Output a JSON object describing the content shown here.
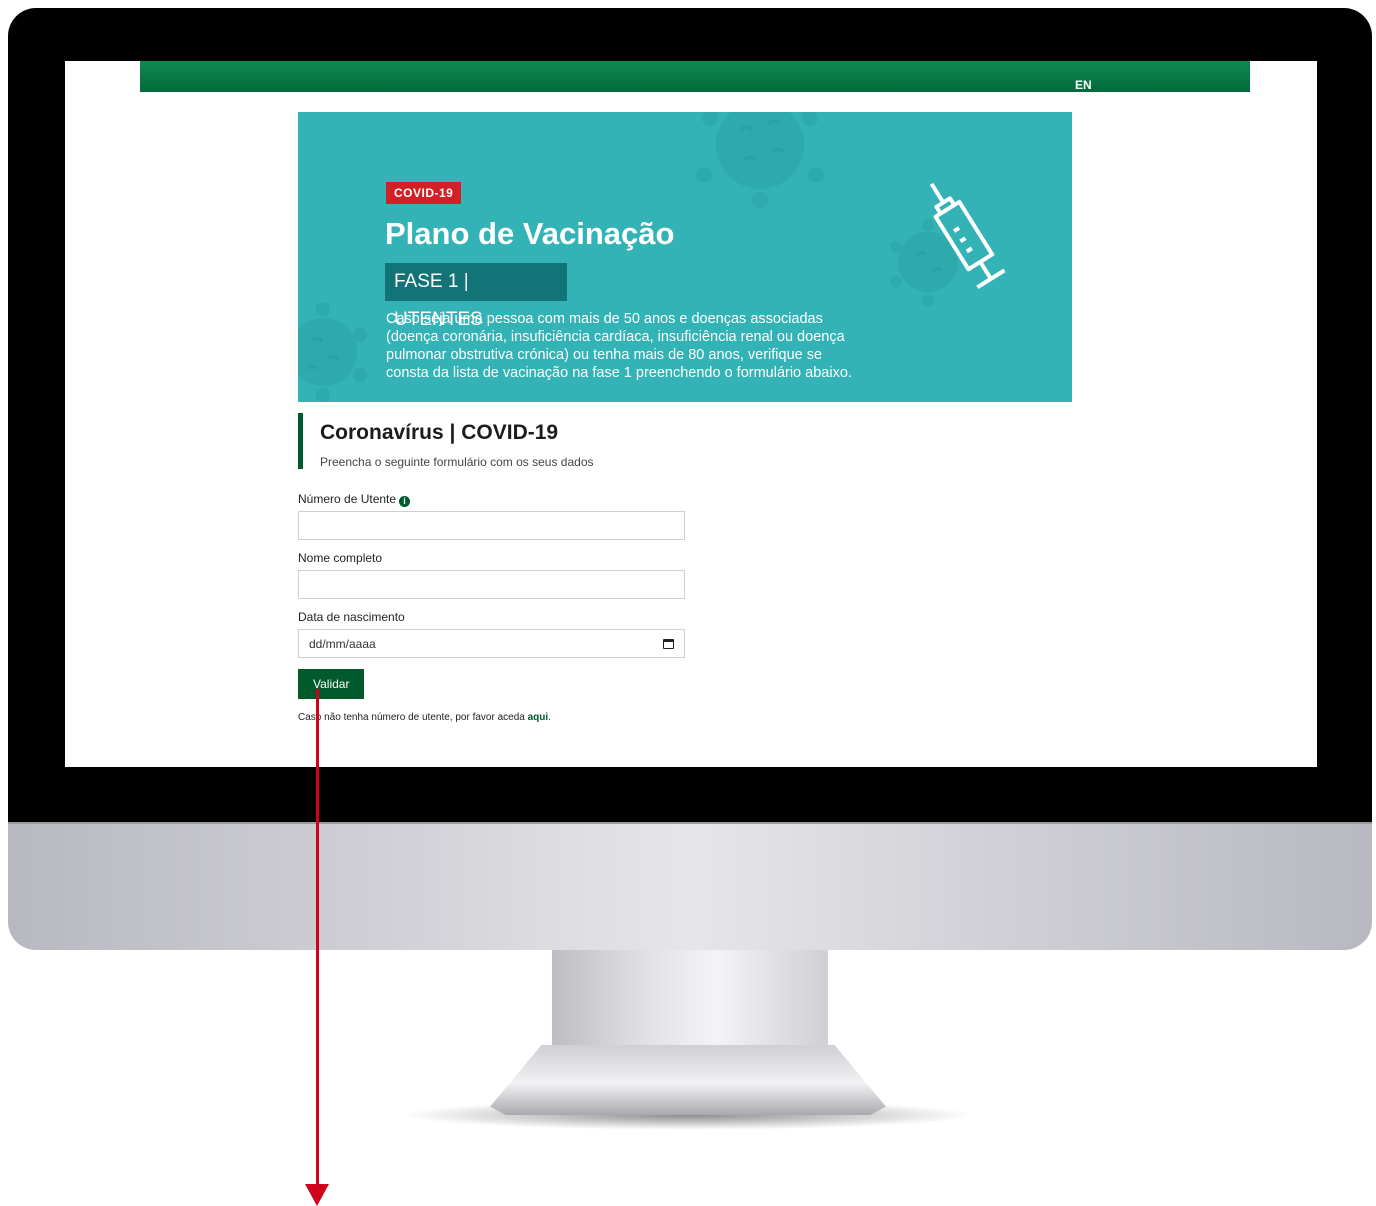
{
  "header": {
    "lang_label": "EN"
  },
  "banner": {
    "badge": "COVID-19",
    "title": "Plano de Vacinação",
    "phase": "FASE 1 | UTENTES",
    "text": "Caso seja uma pessoa com mais de 50 anos e doenças associadas (doença coronária, insuficiência cardíaca, insuficiência renal ou doença pulmonar obstrutiva crónica) ou tenha mais de 80 anos, verifique se consta da lista de vacinação na fase 1 preenchendo o formulário abaixo."
  },
  "form": {
    "title": "Coronavírus | COVID-19",
    "subtitle": "Preencha o seguinte formulário com os seus dados",
    "utente_label": "Número de Utente",
    "name_label": "Nome completo",
    "dob_label": "Data de nascimento",
    "dob_placeholder": "dd/mm/aaaa",
    "submit_label": "Validar",
    "footnote_text": "Caso não tenha número de utente, por favor aceda",
    "footnote_link": "aqui",
    "footnote_end": "."
  },
  "colors": {
    "brand_green": "#005a2b",
    "banner_teal": "#33b3b6",
    "badge_red": "#d32027",
    "arrow_red": "#d0021b"
  }
}
